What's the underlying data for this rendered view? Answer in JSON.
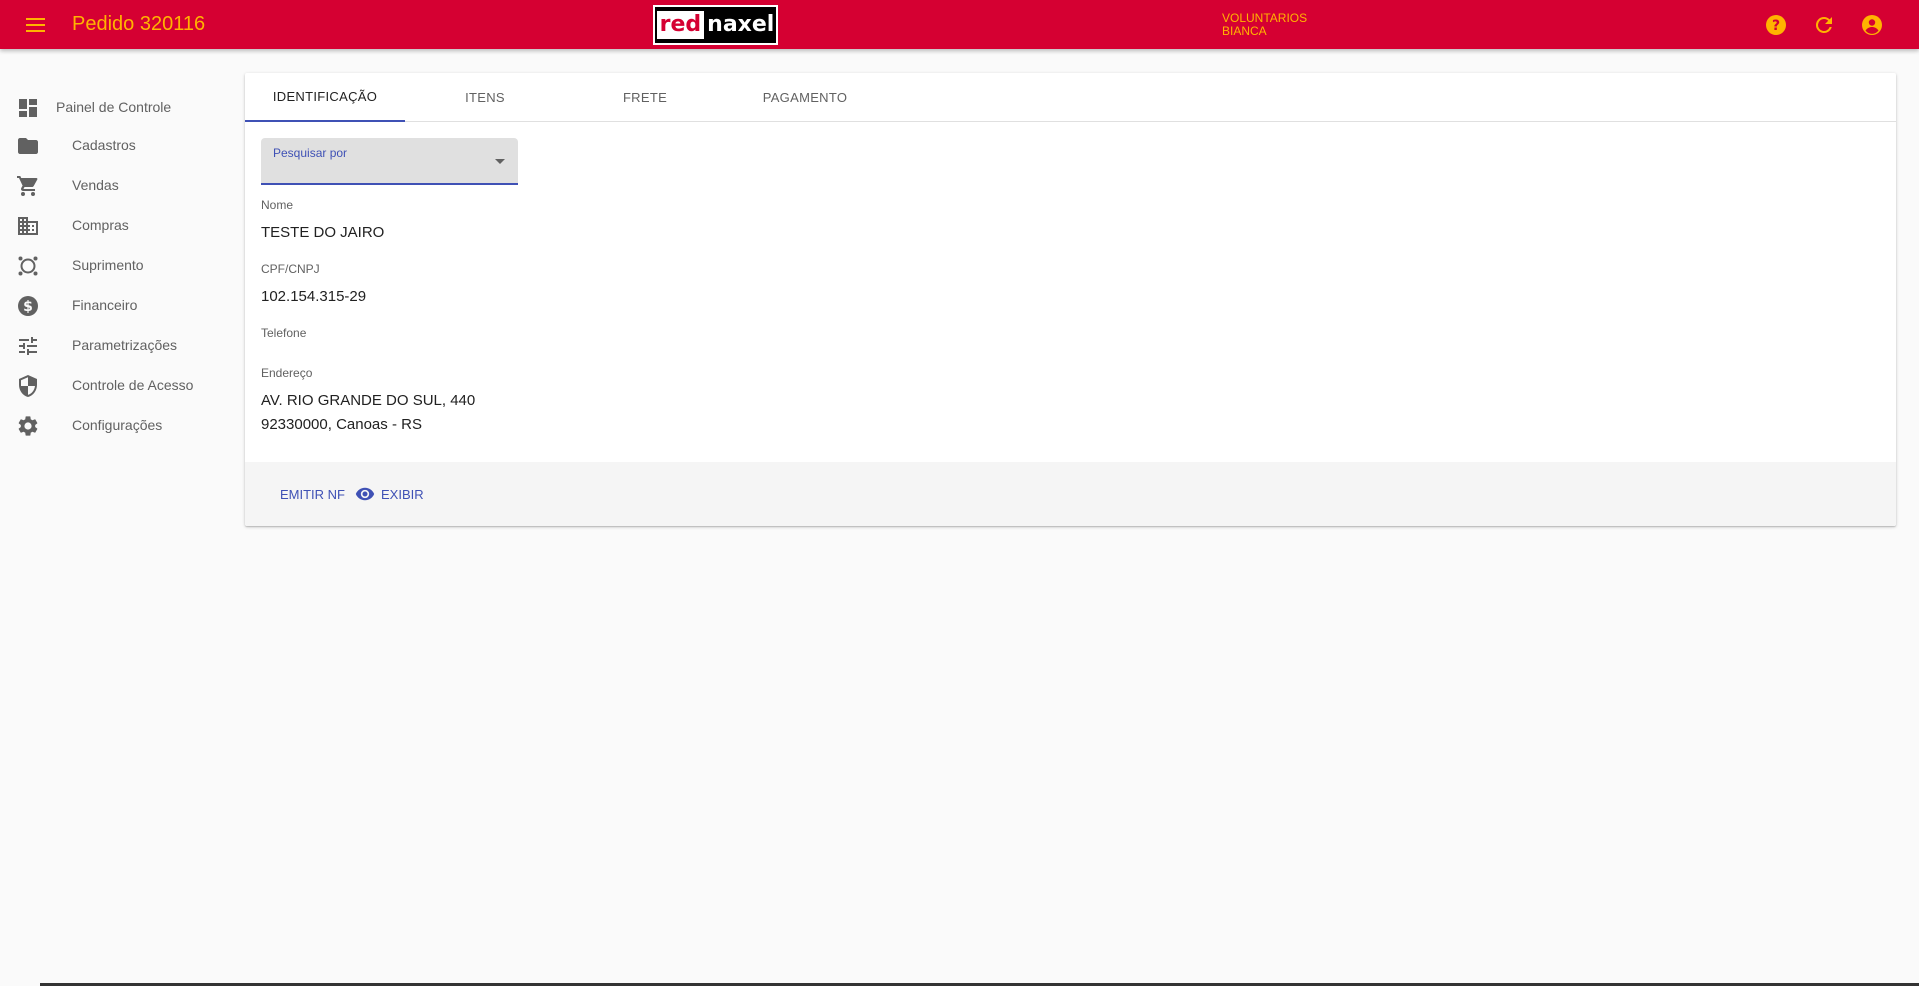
{
  "header": {
    "title": "Pedido 320116",
    "logo_left": "red",
    "logo_right": "naxel",
    "user_line1": "VOLUNTARIOS",
    "user_line2": "BIANCA",
    "icons": [
      "menu-icon",
      "help-icon",
      "refresh-icon",
      "account-icon"
    ],
    "accent_color": "#d50032",
    "icon_color": "#ffb300"
  },
  "sidebar": {
    "items": [
      {
        "label": "Painel de Controle",
        "icon": "dashboard-icon"
      },
      {
        "label": "Cadastros",
        "icon": "folder-icon"
      },
      {
        "label": "Vendas",
        "icon": "cart-icon"
      },
      {
        "label": "Compras",
        "icon": "building-icon"
      },
      {
        "label": "Suprimento",
        "icon": "supply-icon"
      },
      {
        "label": "Financeiro",
        "icon": "money-icon"
      },
      {
        "label": "Parametrizações",
        "icon": "tune-icon"
      },
      {
        "label": "Controle de Acesso",
        "icon": "shield-icon"
      },
      {
        "label": "Configurações",
        "icon": "gear-icon"
      }
    ]
  },
  "tabs": [
    {
      "label": "Identificação",
      "active": true
    },
    {
      "label": "Itens",
      "active": false
    },
    {
      "label": "Frete",
      "active": false
    },
    {
      "label": "Pagamento",
      "active": false
    }
  ],
  "form": {
    "search_label": "Pesquisar por",
    "search_value": "",
    "nome_label": "Nome",
    "nome_value": "TESTE DO JAIRO",
    "cpf_label": "CPF/CNPJ",
    "cpf_value": "102.154.315-29",
    "telefone_label": "Telefone",
    "telefone_value": "",
    "endereco_label": "Endereço",
    "endereco_line1": "AV. RIO GRANDE DO SUL, 440",
    "endereco_line2": "92330000, Canoas - RS"
  },
  "actions": {
    "emitir_label": "Emitir NF",
    "exibir_label": "Exibir",
    "exibir_icon": "eye-icon",
    "primary_color": "#3f51b5"
  }
}
